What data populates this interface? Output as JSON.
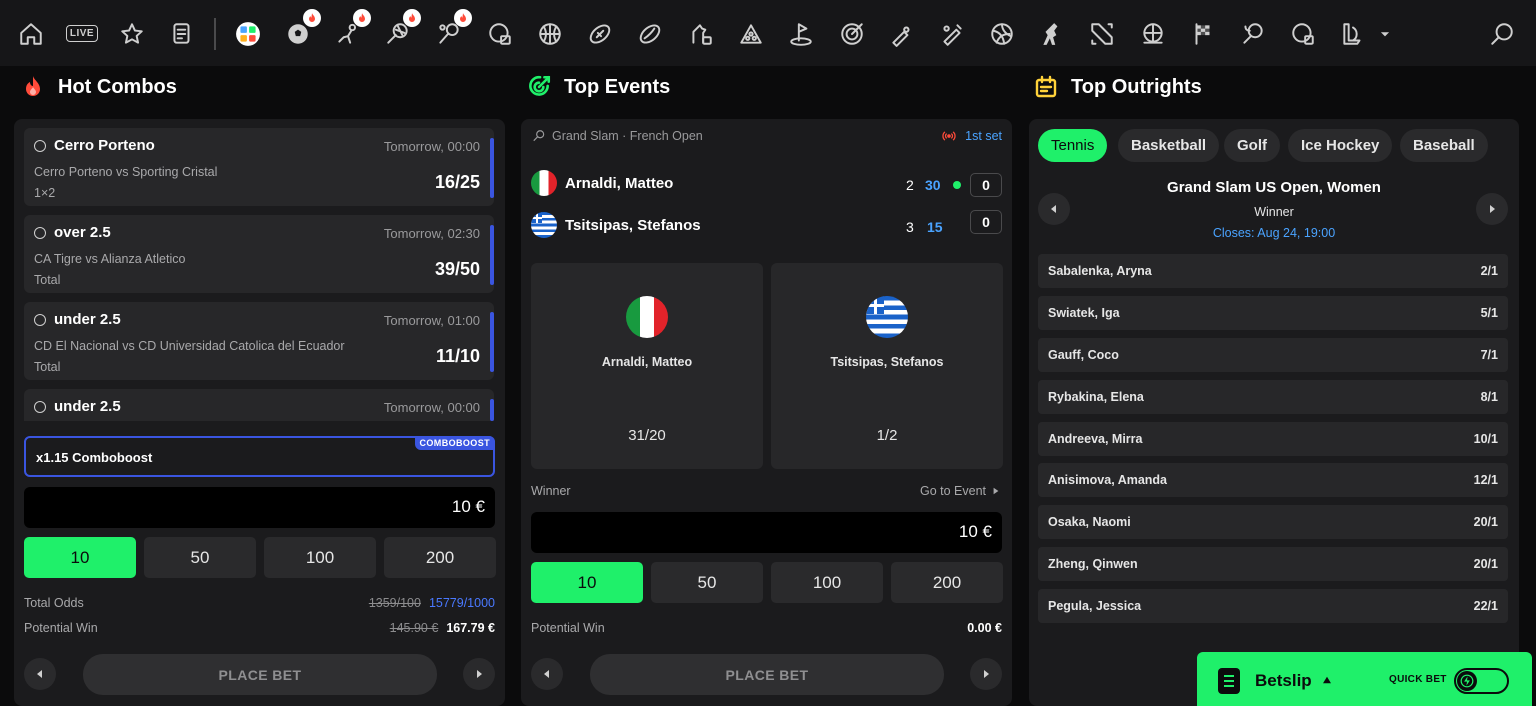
{
  "topbar": {
    "live_label": "LIVE",
    "icons": [
      "home-icon",
      "live-icon",
      "favorites-icon",
      "betslip-history-icon",
      "all-sports-icon",
      "soccer-icon",
      "ice-hockey-icon",
      "tennis-icon",
      "table-tennis-icon",
      "esoccer-icon",
      "basketball-icon",
      "american-football-icon",
      "rugby-icon",
      "horse-racing-icon",
      "snooker-icon",
      "golf-icon",
      "darts-icon",
      "baseball-icon",
      "cricket-icon",
      "volleyball-icon",
      "counter-strike-icon",
      "dota-icon",
      "handball-icon",
      "motorsport-icon",
      "badminton-icon",
      "hockey-icon",
      "league-of-legends-icon",
      "chevron-down-icon",
      "search-icon"
    ]
  },
  "hot_combos": {
    "title": "Hot Combos",
    "cards": [
      {
        "title": "Cerro Porteno",
        "time": "Tomorrow, 00:00",
        "match": "Cerro Porteno vs Sporting Cristal",
        "market": "1×2",
        "odds": "16/25"
      },
      {
        "title": "over 2.5",
        "time": "Tomorrow, 02:30",
        "match": "CA Tigre vs Alianza Atletico",
        "market": "Total",
        "odds": "39/50"
      },
      {
        "title": "under 2.5",
        "time": "Tomorrow, 01:00",
        "match": "CD El Nacional vs CD Universidad Catolica del Ecuador",
        "market": "Total",
        "odds": "11/10"
      },
      {
        "title": "under 2.5",
        "time": "Tomorrow, 00:00",
        "match": "",
        "market": "",
        "odds": ""
      }
    ],
    "boost_label": "x1.15 Comboboost",
    "boost_tag": "COMBOBOOST",
    "stake": "10 €",
    "quick_stakes": [
      "10",
      "50",
      "100",
      "200"
    ],
    "total_odds_label": "Total Odds",
    "total_odds_old": "1359/100",
    "total_odds_new": "15779/1000",
    "potential_win_label": "Potential Win",
    "potential_win_old": "145.90 €",
    "potential_win_new": "167.79 €",
    "place_bet": "PLACE BET"
  },
  "top_events": {
    "title": "Top Events",
    "competition": "Grand Slam · French Open",
    "status": "1st set",
    "players": [
      {
        "name": "Arnaldi, Matteo",
        "sets": "2",
        "games": "30",
        "points": "0",
        "serving": true
      },
      {
        "name": "Tsitsipas, Stefanos",
        "sets": "3",
        "games": "15",
        "points": "0",
        "serving": false
      }
    ],
    "outcomes": [
      {
        "name": "Arnaldi, Matteo",
        "odds": "31/20"
      },
      {
        "name": "Tsitsipas, Stefanos",
        "odds": "1/2"
      }
    ],
    "market": "Winner",
    "go_to_event": "Go to Event",
    "stake": "10 €",
    "quick_stakes": [
      "10",
      "50",
      "100",
      "200"
    ],
    "potential_win_label": "Potential Win",
    "potential_win": "0.00 €",
    "place_bet": "PLACE BET"
  },
  "top_outrights": {
    "title": "Top Outrights",
    "tabs": [
      "Tennis",
      "Basketball",
      "Golf",
      "Ice Hockey",
      "Baseball"
    ],
    "event_title": "Grand Slam US Open, Women",
    "market": "Winner",
    "closes": "Closes: Aug 24, 19:00",
    "rows": [
      {
        "name": "Sabalenka, Aryna",
        "odds": "2/1"
      },
      {
        "name": "Swiatek, Iga",
        "odds": "5/1"
      },
      {
        "name": "Gauff, Coco",
        "odds": "7/1"
      },
      {
        "name": "Rybakina, Elena",
        "odds": "8/1"
      },
      {
        "name": "Andreeva, Mirra",
        "odds": "10/1"
      },
      {
        "name": "Anisimova, Amanda",
        "odds": "12/1"
      },
      {
        "name": "Osaka, Naomi",
        "odds": "20/1"
      },
      {
        "name": "Zheng, Qinwen",
        "odds": "20/1"
      },
      {
        "name": "Pegula, Jessica",
        "odds": "22/1"
      }
    ]
  },
  "betslip": {
    "label": "Betslip",
    "quick_bet": "QUICK BET"
  },
  "colors": {
    "accent_green": "#1ff06a",
    "accent_blue": "#3a55e0",
    "live_red": "#ff4b3a"
  }
}
